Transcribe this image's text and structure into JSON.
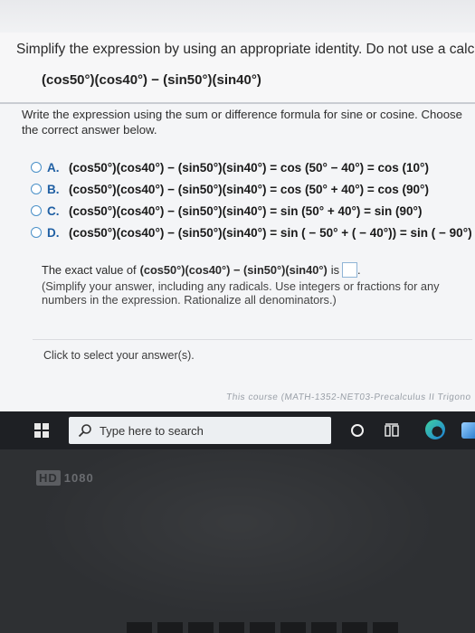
{
  "problem": {
    "title": "Simplify the expression by using an appropriate identity. Do not use a calculator.",
    "expression": "(cos50°)(cos40°) − (sin50°)(sin40°)"
  },
  "instruction": "Write the expression using the sum or difference formula for sine or cosine. Choose the correct answer below.",
  "choices": [
    {
      "letter": "A.",
      "text": "(cos50°)(cos40°) − (sin50°)(sin40°) = cos (50° − 40°) = cos (10°)"
    },
    {
      "letter": "B.",
      "text": "(cos50°)(cos40°) − (sin50°)(sin40°) = cos (50° + 40°) = cos (90°)"
    },
    {
      "letter": "C.",
      "text": "(cos50°)(cos40°) − (sin50°)(sin40°) = sin (50° + 40°) = sin (90°)"
    },
    {
      "letter": "D.",
      "text": "(cos50°)(cos40°) − (sin50°)(sin40°) = sin ( − 50° + ( − 40°)) = sin ( − 90°)"
    }
  ],
  "answer": {
    "prefix": "The exact value of",
    "expression": "(cos50°)(cos40°) − (sin50°)(sin40°)",
    "suffix": "is",
    "end": ".",
    "note": "(Simplify your answer, including any radicals. Use integers or fractions for any numbers in the expression. Rationalize all denominators.)"
  },
  "click_hint": "Click to select your answer(s).",
  "footer_strip": "This course (MATH-1352-NET03-Precalculus II Trigono",
  "taskbar": {
    "search_placeholder": "Type here to search"
  },
  "monitor_badge": {
    "hd": "HD",
    "resolution": "1080"
  },
  "colors": {
    "accent": "#1f5fa3",
    "radio": "#4a90c8",
    "taskbar": "#1e2024"
  }
}
